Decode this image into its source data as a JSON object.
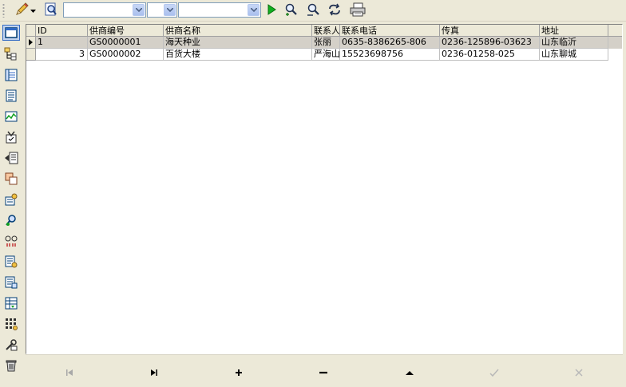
{
  "toolbar": {
    "combo1_value": "",
    "combo2_value": "",
    "combo3_value": ""
  },
  "grid": {
    "columns": [
      "ID",
      "供商编号",
      "供商名称",
      "联系人",
      "联系电话",
      "传真",
      "地址"
    ],
    "rows": [
      {
        "id": "1",
        "code": "GS0000001",
        "name": "海天种业",
        "contact": "张丽",
        "phone": "0635-8386265-806",
        "fax": "0236-125896-03623",
        "address": "山东临沂"
      },
      {
        "id": "3",
        "code": "GS0000002",
        "name": "百货大楼",
        "contact": "严海山",
        "phone": "15523698756",
        "fax": "0236-01258-025",
        "address": "山东聊城"
      }
    ]
  },
  "colors": {
    "window_bg": "#ece9d8",
    "selected_row": "#d4d0c8",
    "accent": "#316ac5"
  },
  "icons": {
    "toolbar": [
      "pencil-icon",
      "find-icon",
      "run-icon",
      "filter-icon",
      "search-icon",
      "refresh-icon",
      "print-icon"
    ],
    "navigator": [
      "first-icon",
      "last-icon",
      "insert-icon",
      "delete-icon",
      "edit-icon",
      "post-icon",
      "cancel-icon"
    ]
  }
}
